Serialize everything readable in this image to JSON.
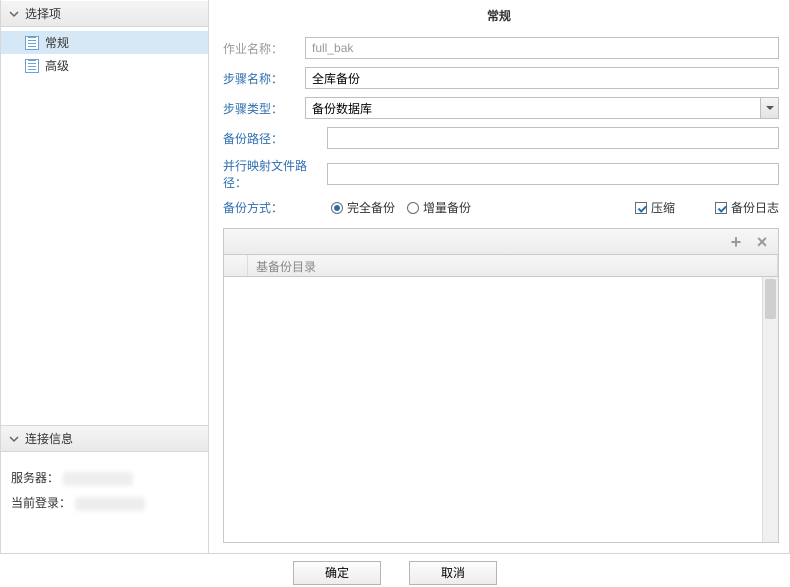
{
  "sidebar": {
    "options_title": "选择项",
    "items": [
      {
        "label": "常规"
      },
      {
        "label": "高级"
      }
    ],
    "conn_title": "连接信息",
    "server_label": "服务器：",
    "login_label": "当前登录："
  },
  "panel": {
    "title": "常规",
    "job_name_label": "作业名称：",
    "job_name_value": "full_bak",
    "step_name_label": "步骤名称：",
    "step_name_value": "全库备份",
    "step_type_label": "步骤类型：",
    "step_type_value": "备份数据库",
    "backup_path_label": "备份路径：",
    "backup_path_value": "",
    "parallel_map_label": "并行映射文件路径：",
    "parallel_map_value": "",
    "backup_mode_label": "备份方式：",
    "radio_full": "完全备份",
    "radio_incr": "增量备份",
    "check_compress": "压缩",
    "check_log": "备份日志",
    "grid_col1": "基备份目录"
  },
  "footer": {
    "ok": "确定",
    "cancel": "取消"
  }
}
